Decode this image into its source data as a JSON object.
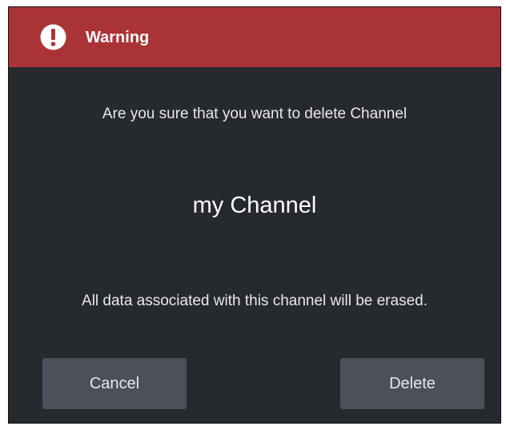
{
  "dialog": {
    "title": "Warning",
    "icon": "exclamation-circle-icon",
    "accent_color": "#aa3337",
    "message_line1": "Are you sure that you want to delete Channel",
    "channel_name": "my Channel",
    "message_line2": "All data associated with this channel will be erased.",
    "cancel_label": "Cancel",
    "delete_label": "Delete"
  }
}
